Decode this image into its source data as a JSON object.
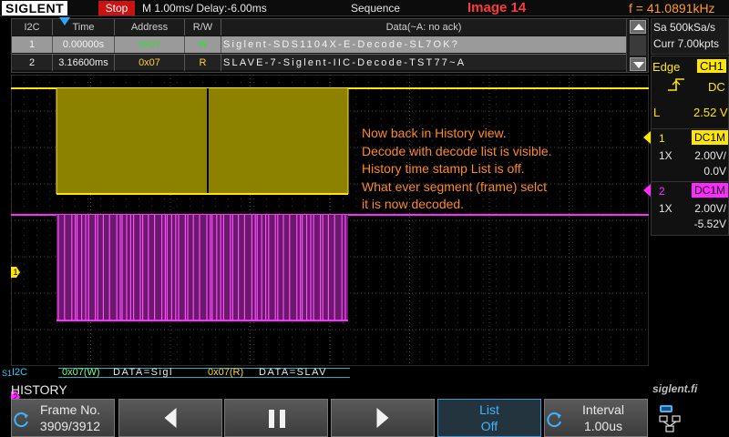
{
  "topbar": {
    "brand": "SIGLENT",
    "run_state": "Stop",
    "timebase": "M 1.00ms/ Delay:-6.00ms",
    "acq_mode": "Sequence",
    "image_label": "Image 14",
    "frequency": "f = 41.0891kHz"
  },
  "decode_table": {
    "headers": [
      "I2C",
      "Time",
      "Address",
      "R/W",
      "Data(~A: no ack)"
    ],
    "rows": [
      {
        "index": "1",
        "time": "0.00000s",
        "address": "0x07",
        "rw": "W",
        "data": "Siglent-SDS1104X-E-Decode-SL7OK?",
        "selected": true
      },
      {
        "index": "2",
        "time": "3.16600ms",
        "address": "0x07",
        "rw": "R",
        "data": "SLAVE-7-Siglent-IIC-Decode-TST77~A",
        "selected": false
      }
    ]
  },
  "annotation": [
    "Now back in History view.",
    "Decode with decode list  is visible.",
    "History time stamp List is off.",
    "What ever segment (frame) selct",
    "it is now decoded."
  ],
  "channel_markers": {
    "ch1": "1",
    "ch2": "2"
  },
  "bus": {
    "label": "I2C",
    "s_marker": "S1",
    "packets": [
      {
        "address": "0x07(W)",
        "data": "DATA=Sigl"
      },
      {
        "address": "0x07(R)",
        "data": "DATA=SLAV"
      }
    ]
  },
  "acquisition": {
    "sample_rate": "Sa 500kSa/s",
    "memory": "Curr 7.00kpts"
  },
  "trigger": {
    "type": "Edge",
    "source": "CH1",
    "coupling": "DC",
    "level_label": "L",
    "level": "2.52 V"
  },
  "channels": [
    {
      "num": "1",
      "coupling": "DC1M",
      "probe": "1X",
      "scale": "2.00V/",
      "offset": "0.0V",
      "color": "#ffe600"
    },
    {
      "num": "2",
      "coupling": "DC1M",
      "probe": "1X",
      "scale": "2.00V/",
      "offset": "-5.52V",
      "color": "#ff2aff"
    }
  ],
  "menu": {
    "title": "HISTORY",
    "brand_site": "siglent.fi",
    "frame_label": "Frame No.",
    "frame_value": "3909/3912",
    "list_label": "List",
    "list_value": "Off",
    "interval_label": "Interval",
    "interval_value": "1.00us"
  },
  "colors": {
    "ch1": "#ffe600",
    "ch2": "#ff2aff",
    "bus": "#28d0ff",
    "annotation": "#ff8a1f",
    "list_active": "#3fb4ff"
  }
}
